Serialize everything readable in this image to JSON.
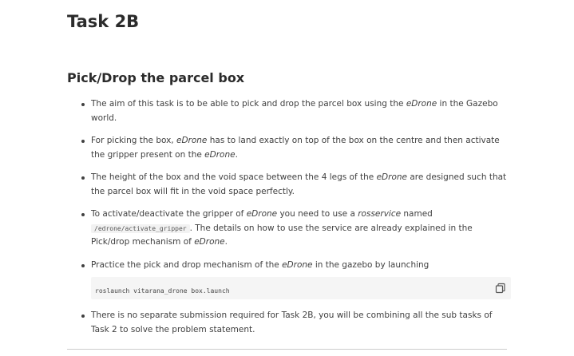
{
  "page": {
    "title": "Task 2B"
  },
  "section": {
    "title": "Pick/Drop the parcel box"
  },
  "bullets": [
    {
      "parts": [
        "The aim of this task is to be able to pick and drop the parcel box using the ",
        "eDrone",
        " in the Gazebo world."
      ]
    },
    {
      "parts": [
        "For picking the box, ",
        "eDrone",
        " has to land exactly on top of the box on the centre and then activate the gripper present on the ",
        "eDrone",
        "."
      ]
    },
    {
      "parts": [
        "The height of the box and the void space between the 4 legs of the ",
        "eDrone",
        " are designed such that the parcel box will fit in the void space perfectly."
      ]
    },
    {
      "parts": [
        "To activate/deactivate the gripper of ",
        "eDrone",
        " you need to use a ",
        "rosservice",
        " named ",
        "/edrone/activate_gripper",
        ". The details on how to use the service are already explained in the Pick/drop mechanism of ",
        "eDrone",
        "."
      ]
    },
    {
      "parts": [
        "Practice the pick and drop mechanism of the ",
        "eDrone",
        " in the gazebo by launching"
      ]
    },
    {
      "parts": [
        "There is no separate submission required for Task 2B, you will be combining all the sub tasks of Task 2 to solve the problem statement."
      ]
    }
  ],
  "code_block": {
    "command": "roslaunch vitarana_drone box.launch",
    "copy_icon": "copy-icon"
  }
}
